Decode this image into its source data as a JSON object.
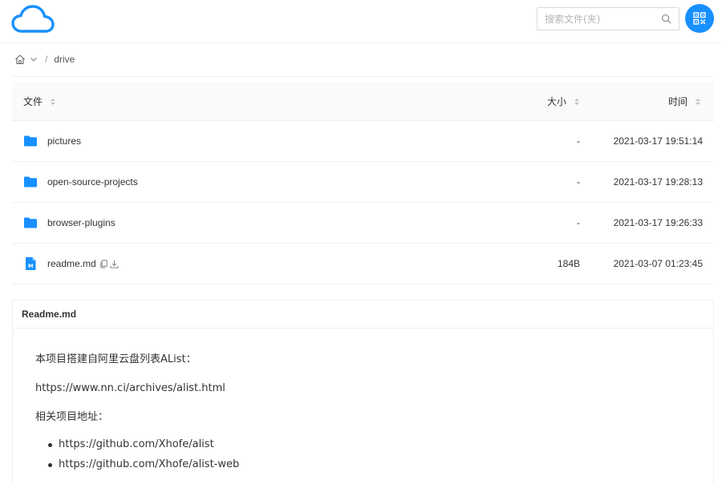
{
  "header": {
    "search_placeholder": "搜索文件(夹)",
    "logo_icon": "cloud-icon",
    "search_icon": "search-icon",
    "qr_icon": "qrcode-icon",
    "accent": "#1890ff"
  },
  "breadcrumb": {
    "home_icon": "home-icon",
    "separator": "/",
    "current": "drive"
  },
  "table": {
    "columns": {
      "name": "文件",
      "size": "大小",
      "time": "时间"
    },
    "rows": [
      {
        "name": "pictures",
        "type": "folder",
        "size": "-",
        "time": "2021-03-17 19:51:14"
      },
      {
        "name": "open-source-projects",
        "type": "folder",
        "size": "-",
        "time": "2021-03-17 19:28:13"
      },
      {
        "name": "browser-plugins",
        "type": "folder",
        "size": "-",
        "time": "2021-03-17 19:26:33"
      },
      {
        "name": "readme.md",
        "type": "markdown",
        "size": "184B",
        "time": "2021-03-07 01:23:45"
      }
    ]
  },
  "readme": {
    "title": "Readme.md",
    "line1": "本项目搭建自阿里云盘列表AList：",
    "line2": "https://www.nn.ci/archives/alist.html",
    "line3": "相关项目地址：",
    "links": [
      "https://github.com/Xhofe/alist",
      "https://github.com/Xhofe/alist-web"
    ]
  }
}
